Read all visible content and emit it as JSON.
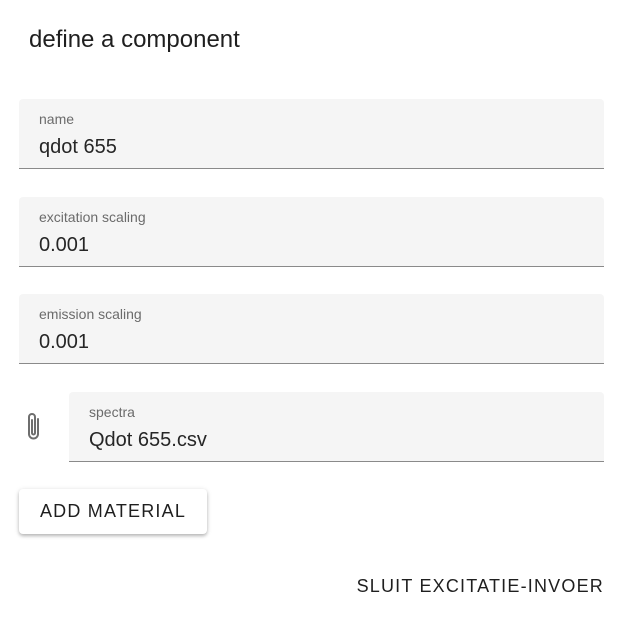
{
  "dialog": {
    "title": "define a component"
  },
  "fields": {
    "name": {
      "label": "name",
      "value": "qdot 655"
    },
    "excitation_scaling": {
      "label": "excitation scaling",
      "value": "0.001"
    },
    "emission_scaling": {
      "label": "emission scaling",
      "value": "0.001"
    },
    "spectra": {
      "label": "spectra",
      "value": "Qdot 655.csv",
      "icon": "paperclip-icon"
    }
  },
  "actions": {
    "add_material": "ADD MATERIAL",
    "close_excitation_input": "SLUIT EXCITATIE-INVOER"
  },
  "colors": {
    "field_background": "#f5f5f5",
    "field_underline": "#8a8a8a",
    "label_text": "#6b6b6b",
    "value_text": "#262626"
  }
}
